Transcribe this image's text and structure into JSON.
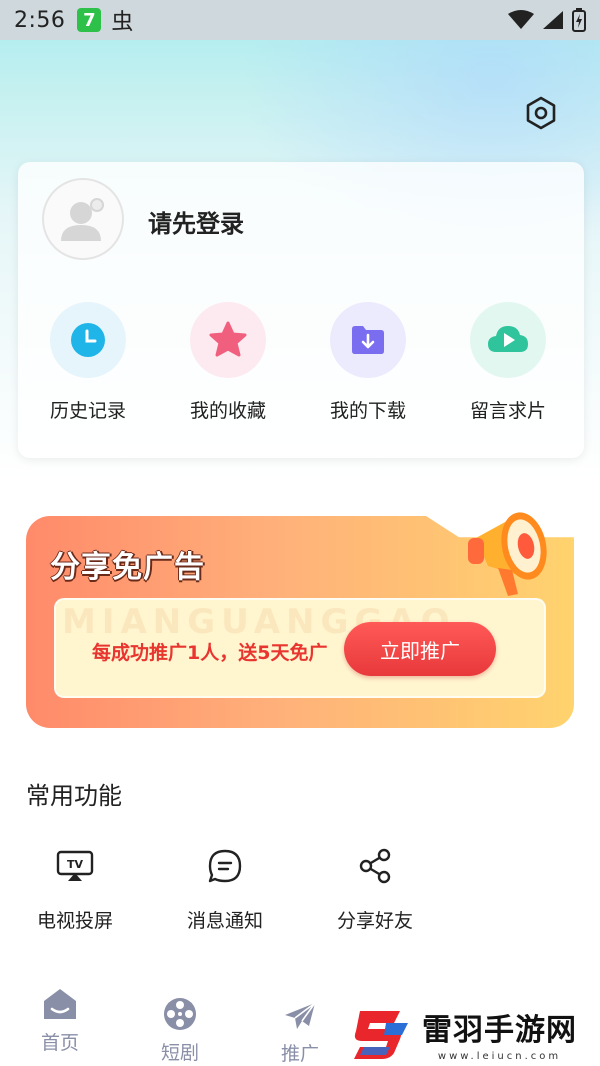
{
  "status_bar": {
    "time": "2:56",
    "app_badge": "7",
    "bug_glyph": "虫"
  },
  "profile": {
    "login_prompt": "请先登录",
    "avatar_icon": "user-placeholder-icon"
  },
  "quick_actions": [
    {
      "label": "历史记录",
      "icon": "clock-icon",
      "color": "#1fb5e8",
      "bg": "#e6f5fb"
    },
    {
      "label": "我的收藏",
      "icon": "star-icon",
      "color": "#f0607e",
      "bg": "#fdeaf0"
    },
    {
      "label": "我的下载",
      "icon": "download-folder-icon",
      "color": "#7a6df0",
      "bg": "#eceafd"
    },
    {
      "label": "留言求片",
      "icon": "cloud-play-icon",
      "color": "#2fc49b",
      "bg": "#e3f7f1"
    }
  ],
  "promo": {
    "title": "分享免广告",
    "watermark": "MIANGUANGGAO",
    "text": "每成功推广1人，送5天免广",
    "button": "立即推广"
  },
  "features": {
    "section_title": "常用功能",
    "items": [
      {
        "label": "电视投屏",
        "icon": "tv-cast-icon"
      },
      {
        "label": "消息通知",
        "icon": "message-icon"
      },
      {
        "label": "分享好友",
        "icon": "share-icon"
      }
    ]
  },
  "bottom_nav": [
    {
      "label": "首页",
      "icon": "home-icon"
    },
    {
      "label": "短剧",
      "icon": "film-reel-icon"
    },
    {
      "label": "推广",
      "icon": "paper-plane-icon"
    }
  ],
  "watermark": {
    "title": "雷羽手游网",
    "url": "www.leiucn.com"
  },
  "colors": {
    "accent_red": "#e8383b",
    "nav_gray": "#8a8fa8"
  }
}
